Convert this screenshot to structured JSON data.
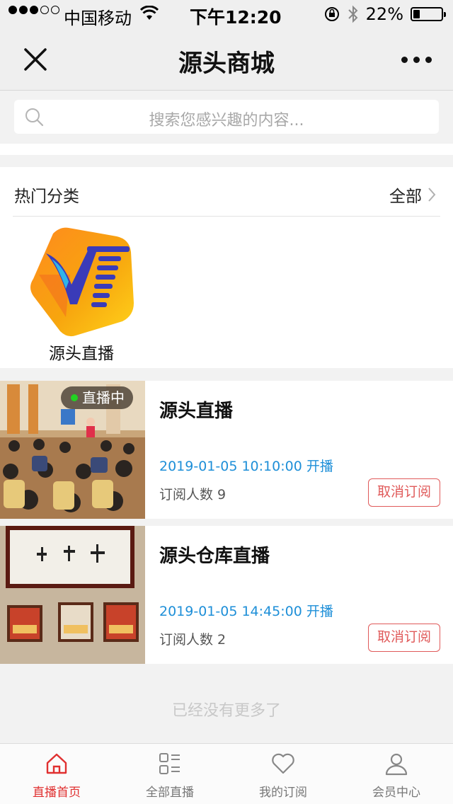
{
  "status_bar": {
    "carrier": "中国移动",
    "time": "下午12:20",
    "battery": "22%",
    "battery_level": 0.22
  },
  "nav": {
    "title": "源头商城"
  },
  "search": {
    "placeholder": "搜索您感兴趣的内容..."
  },
  "category": {
    "title": "热门分类",
    "all_label": "全部",
    "items": [
      {
        "label": "源头直播",
        "icon": "yt-logo-icon"
      }
    ]
  },
  "live_list": [
    {
      "badge": "直播中",
      "title": "源头直播",
      "time": "2019-01-05 10:10:00 开播",
      "subs": "订阅人数 9",
      "button": "取消订阅"
    },
    {
      "title": "源头仓库直播",
      "time": "2019-01-05 14:45:00 开播",
      "subs": "订阅人数 2",
      "button": "取消订阅"
    }
  ],
  "footer_text": "已经没有更多了",
  "tabs": [
    {
      "label": "直播首页",
      "icon": "home-icon",
      "active": true
    },
    {
      "label": "全部直播",
      "icon": "grid-list-icon",
      "active": false
    },
    {
      "label": "我的订阅",
      "icon": "heart-icon",
      "active": false
    },
    {
      "label": "会员中心",
      "icon": "user-icon",
      "active": false
    }
  ],
  "colors": {
    "accent_red": "#e03030",
    "time_blue": "#1e8fd8",
    "live_green": "#22d222"
  }
}
